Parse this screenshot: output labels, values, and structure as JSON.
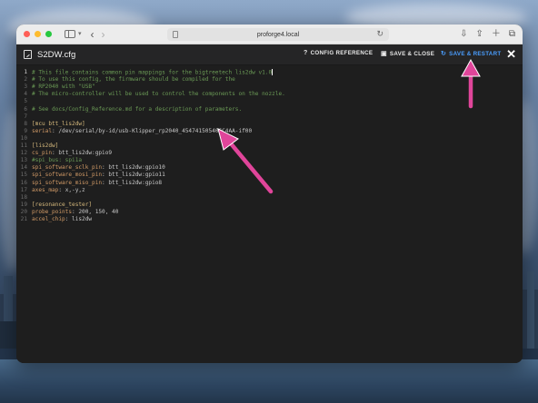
{
  "browser": {
    "url": "proforge4.local"
  },
  "editor": {
    "file_name": "S2DW.cfg",
    "buttons": {
      "config_reference": "CONFIG REFERENCE",
      "save_close": "SAVE & CLOSE",
      "save_restart": "SAVE & RESTART"
    },
    "lines": [
      {
        "n": "1",
        "text": "# This file contains common pin mappings for the bigtreetech lis2dw v1.0",
        "type": "comment"
      },
      {
        "n": "2",
        "text": "# To use this config, the firmware should be compiled for the",
        "type": "comment"
      },
      {
        "n": "3",
        "text": "# RP2040 with \"USB\"",
        "type": "comment"
      },
      {
        "n": "4",
        "text": "# The micro-controller will be used to control the components on the nozzle.",
        "type": "comment"
      },
      {
        "n": "5",
        "text": "",
        "type": "blank"
      },
      {
        "n": "6",
        "text": "# See docs/Config_Reference.md for a description of parameters.",
        "type": "comment"
      },
      {
        "n": "7",
        "text": "",
        "type": "blank"
      },
      {
        "n": "8",
        "text": "[mcu btt_lis2dw]",
        "type": "section"
      },
      {
        "n": "9",
        "key": "serial",
        "value": " /dev/serial/by-id/usb-Klipper_rp2040_454741505406C4AA-if00",
        "type": "kv"
      },
      {
        "n": "10",
        "text": "",
        "type": "blank"
      },
      {
        "n": "11",
        "text": "[lis2dw]",
        "type": "section"
      },
      {
        "n": "12",
        "key": "cs_pin",
        "value": " btt_lis2dw:gpio9",
        "type": "kv"
      },
      {
        "n": "13",
        "text": "#spi_bus: spi1a",
        "type": "comment"
      },
      {
        "n": "14",
        "key": "spi_software_sclk_pin",
        "value": " btt_lis2dw:gpio10",
        "type": "kv"
      },
      {
        "n": "15",
        "key": "spi_software_mosi_pin",
        "value": " btt_lis2dw:gpio11",
        "type": "kv"
      },
      {
        "n": "16",
        "key": "spi_software_miso_pin",
        "value": " btt_lis2dw:gpio8",
        "type": "kv"
      },
      {
        "n": "17",
        "key": "axes_map",
        "value": " x,-y,z",
        "type": "kv"
      },
      {
        "n": "18",
        "text": "",
        "type": "blank"
      },
      {
        "n": "19",
        "text": "[resonance_tester]",
        "type": "section"
      },
      {
        "n": "20",
        "key": "probe_points",
        "value": " 200, 150, 40",
        "type": "kv"
      },
      {
        "n": "21",
        "key": "accel_chip",
        "value": " lis2dw",
        "type": "kv"
      }
    ]
  },
  "colors": {
    "accent": "#4a9eff",
    "annotation_arrow": "#e0459a",
    "comment": "#6a9955",
    "section": "#d7ba7d",
    "key": "#d19a66"
  }
}
